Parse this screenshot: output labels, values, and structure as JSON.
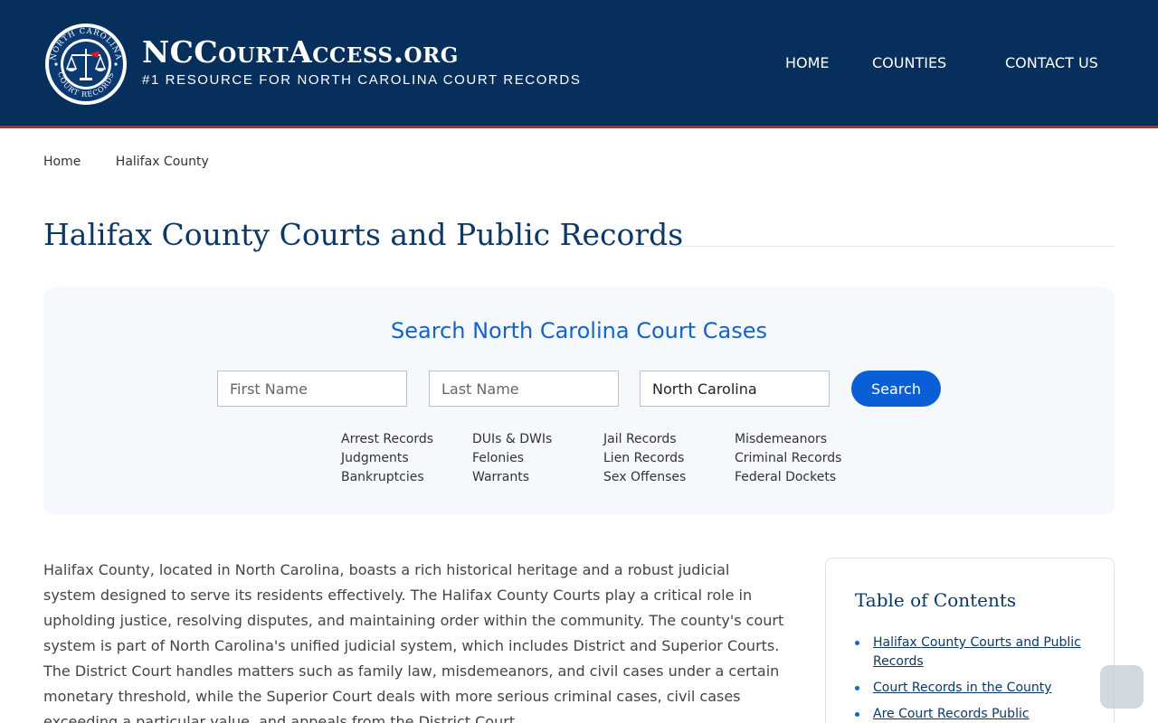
{
  "header": {
    "brand_name": "NCCourtAccess.org",
    "brand_tagline": "#1 Resource for North Carolina Court Records",
    "seal_text_top": "NORTH CAROLINA",
    "seal_text_bottom": "COURT RECORDS",
    "nav": [
      {
        "label": "HOME"
      },
      {
        "label": "COUNTIES"
      },
      {
        "label": "CONTACT US"
      }
    ]
  },
  "breadcrumb": [
    {
      "label": "Home"
    },
    {
      "label": "Halifax County"
    }
  ],
  "page": {
    "title": "Halifax County Courts and Public Records"
  },
  "search": {
    "heading": "Search North Carolina Court Cases",
    "first_name_placeholder": "First Name",
    "last_name_placeholder": "Last Name",
    "state_value": "North Carolina",
    "button_label": "Search",
    "links": [
      [
        "Arrest Records",
        "Judgments",
        "Bankruptcies"
      ],
      [
        "DUIs & DWIs",
        "Felonies",
        "Warrants"
      ],
      [
        "Jail Records",
        "Lien Records",
        "Sex Offenses"
      ],
      [
        "Misdemeanors",
        "Criminal Records",
        "Federal Dockets"
      ]
    ]
  },
  "article": {
    "paragraph": "Halifax County, located in North Carolina, boasts a rich historical heritage and a robust judicial system designed to serve its residents effectively. The Halifax County Courts play a critical role in upholding justice, resolving disputes, and maintaining order within the community. The county's court system is part of North Carolina's unified judicial system, which includes District and Superior Courts. The District Court handles matters such as family law, misdemeanors, and civil cases under a certain monetary threshold, while the Superior Court deals with more serious criminal cases, civil cases exceeding a particular value, and appeals from the District Court."
  },
  "toc": {
    "title": "Table of Contents",
    "items": [
      {
        "label": "Halifax County Courts and Public Records"
      },
      {
        "label": "Court Records in the County"
      },
      {
        "label": "Are Court Records Public"
      }
    ]
  },
  "colors": {
    "header_bg": "#062f5c",
    "accent_red": "#d21f26",
    "link_blue": "#1464c8",
    "button_blue": "#0a5fd6",
    "title_navy": "#0c3866"
  }
}
